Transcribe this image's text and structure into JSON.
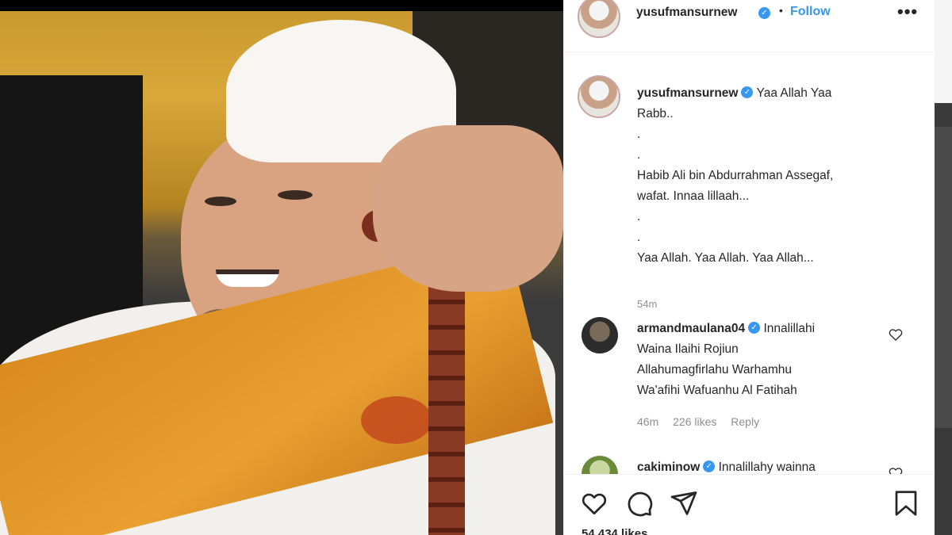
{
  "post": {
    "username": "yusufmansurnew",
    "verified_icon": "verified-badge-icon",
    "separator": "•",
    "follow_label": "Follow",
    "more_label": "•••"
  },
  "caption": {
    "username": "yusufmansurnew",
    "lines": [
      "Yaa Allah Yaa",
      "Rabb..",
      ".",
      ".",
      "Habib Ali bin Abdurrahman Assegaf,",
      "wafat. Innaa lillaah...",
      ".",
      ".",
      "Yaa Allah. Yaa Allah. Yaa Allah..."
    ],
    "time": "54m"
  },
  "comments": [
    {
      "username": "armandmaulana04",
      "lines": [
        "Innalillahi",
        "Waina Ilaihi Rojiun",
        "Allahumagfirlahu Warhamhu",
        "Wa'afihi Wafuanhu Al Fatihah"
      ],
      "time": "46m",
      "likes": "226 likes",
      "reply": "Reply"
    },
    {
      "username": "cakiminow",
      "lines": [
        "Innalillahy wainna"
      ]
    }
  ],
  "actions": {
    "icons": [
      "heart-icon",
      "comment-icon",
      "share-icon",
      "bookmark-icon"
    ],
    "likes": "54,434 likes"
  },
  "colors": {
    "accent": "#3897f0",
    "text": "#262626",
    "muted": "#8e8e8e",
    "border": "#efefef"
  }
}
